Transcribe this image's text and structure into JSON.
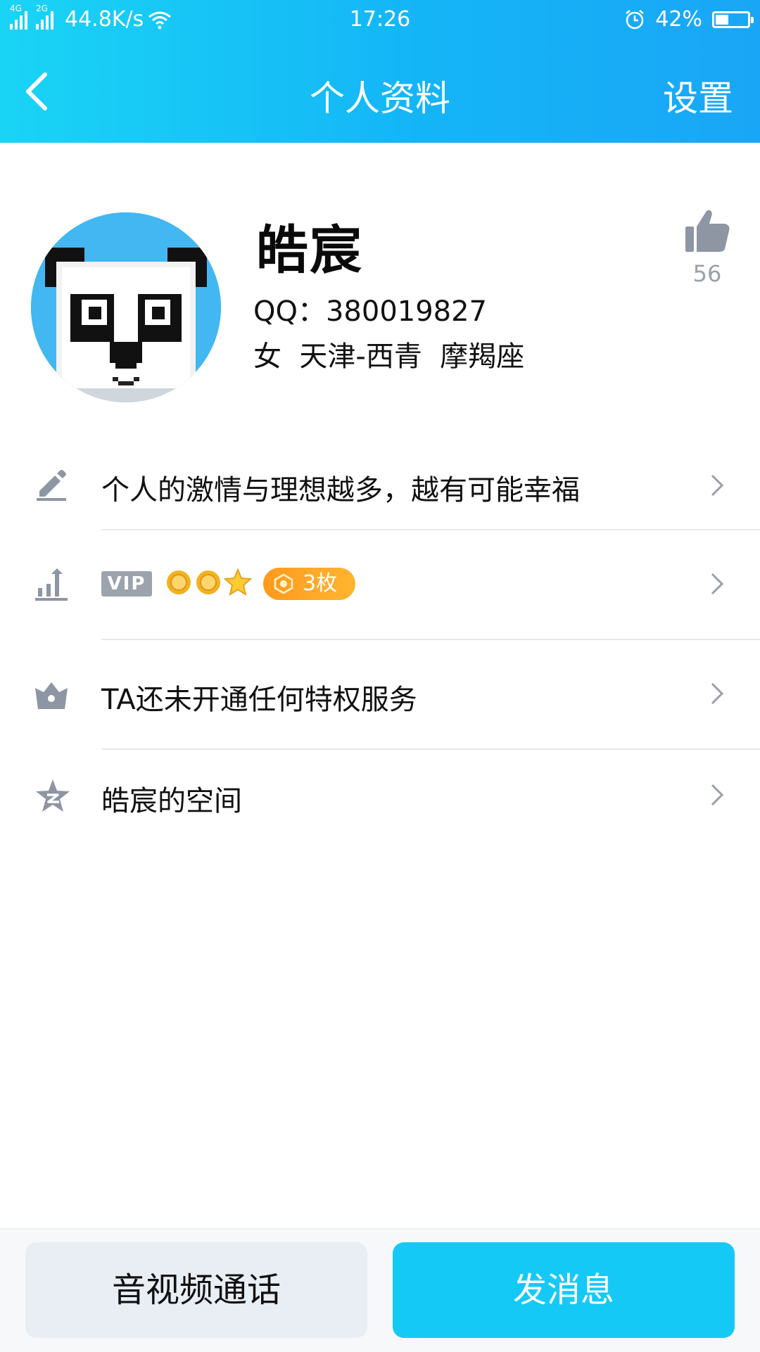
{
  "status_bar": {
    "network_1": "4G",
    "network_2": "2G",
    "speed": "44.8K/s",
    "time": "17:26",
    "battery": "42%",
    "battery_level": 0.42,
    "icons": [
      "signal-icon",
      "wifi-icon",
      "alarm-icon",
      "battery-icon"
    ]
  },
  "nav": {
    "title": "个人资料",
    "settings_label": "设置",
    "back_icon": "chevron-left-icon"
  },
  "profile": {
    "name": "皓宸",
    "qq": "QQ：380019827",
    "info": "女  天津-西青  摩羯座",
    "like_count": "56",
    "avatar": "pixel-panda-avatar"
  },
  "list": {
    "signature": "个人的激情与理想越多，越有可能幸福",
    "vip_label": "VIP",
    "badge_count": "3枚",
    "privilege": "TA还未开通任何特权服务",
    "space": "皓宸的空间"
  },
  "buttons": {
    "call": "音视频通话",
    "message": "发消息"
  },
  "colors": {
    "header_start": "#1ad4f5",
    "header_end": "#1aa6f6",
    "primary_button": "#15c9f7",
    "secondary_button": "#e9edf4",
    "icon_gray": "#8e95a3",
    "badge_orange": "#ff9a1f"
  }
}
